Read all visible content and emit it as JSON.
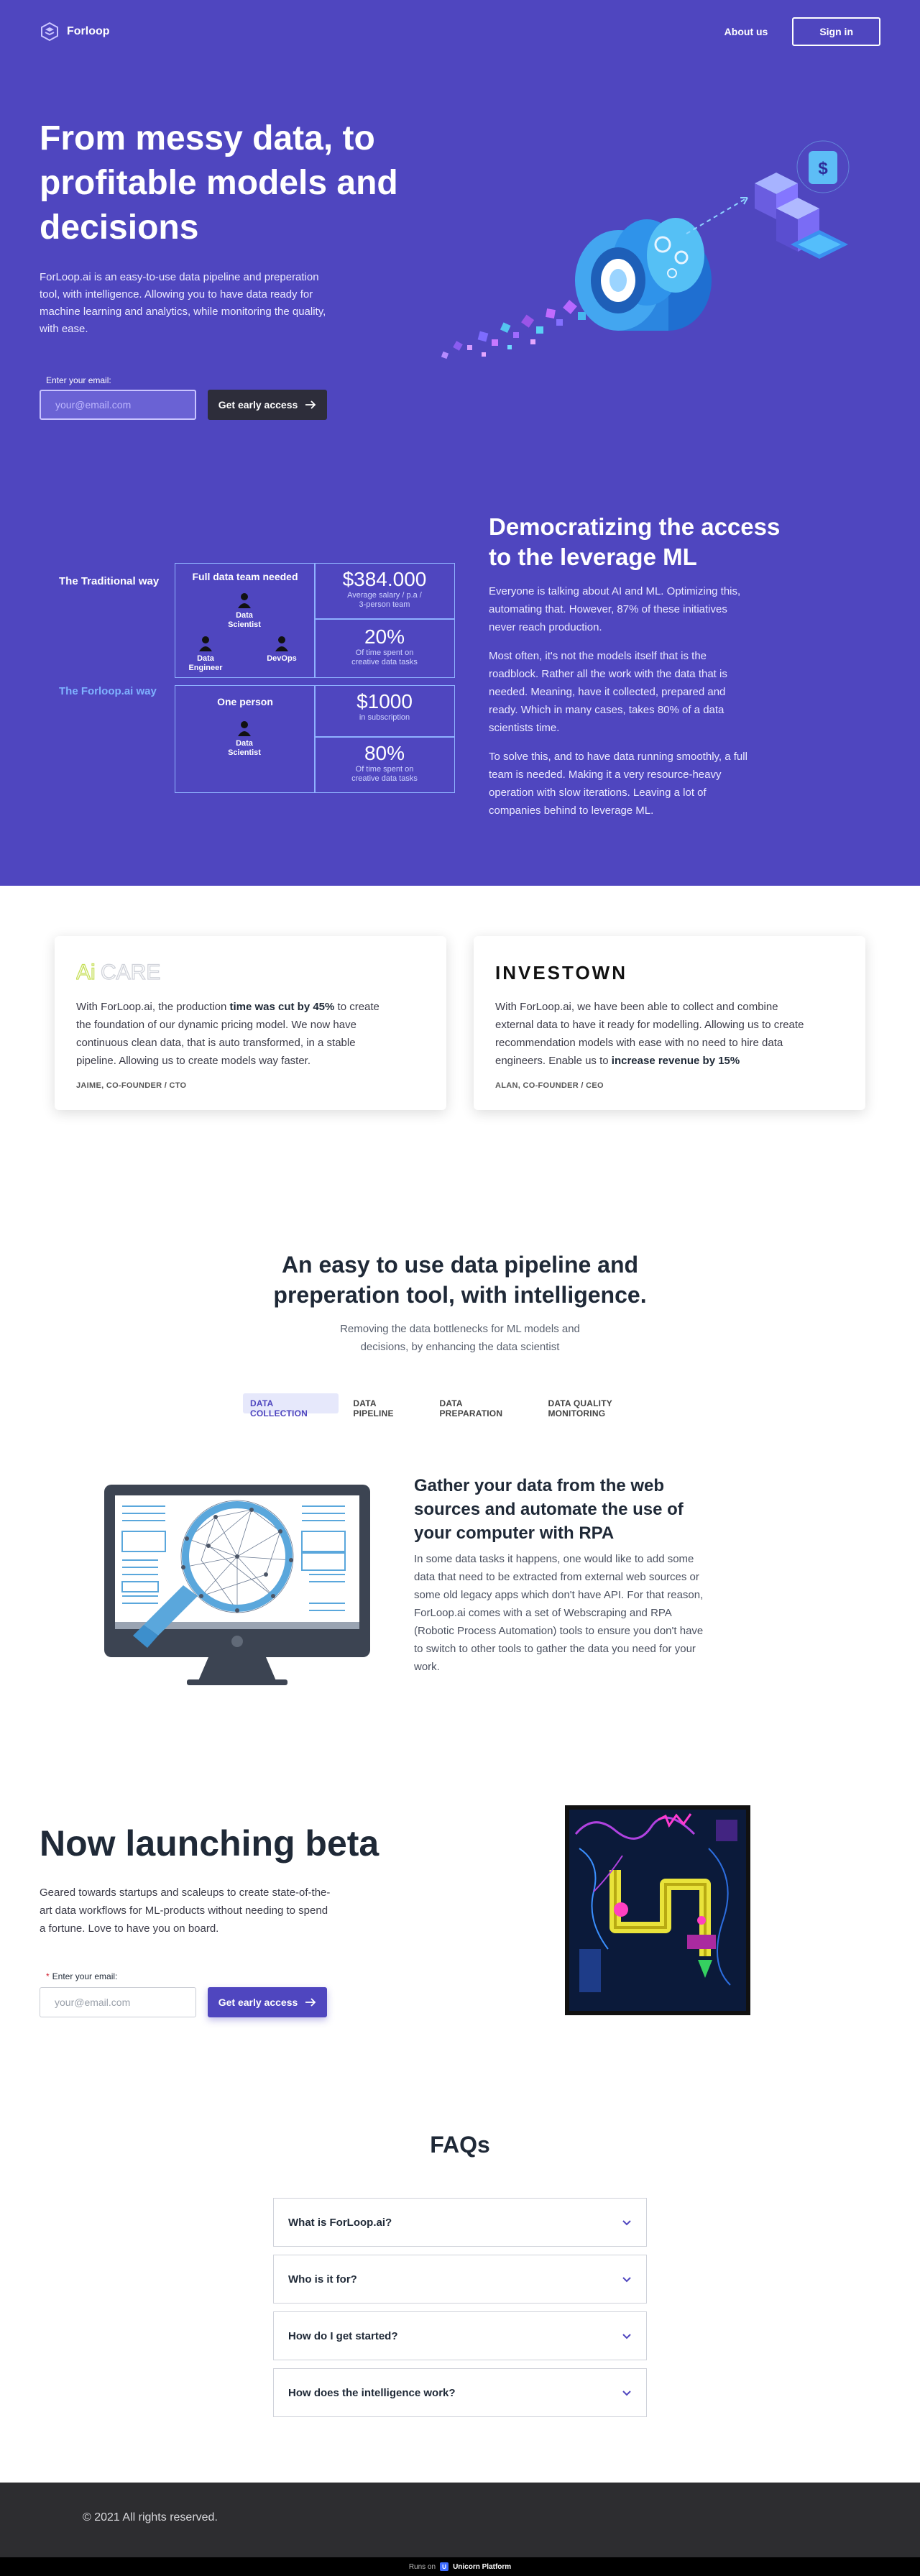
{
  "colors": {
    "brand": "#4f46bf",
    "dark_button": "#2d2d3a",
    "footer": "#2d2d30",
    "traditional": "#ffffff",
    "forloop": "#7fb2ff"
  },
  "nav": {
    "brand_name": "Forloop",
    "about": "About us",
    "signin": "Sign in"
  },
  "hero": {
    "title": "From messy data, to profitable models and decisions",
    "subtitle": "ForLoop.ai is an easy-to-use data pipeline and preperation tool, with intelligence. Allowing you to have data ready for machine learning and analytics, while monitoring the quality, with ease.",
    "email_label": "Enter your email:",
    "email_placeholder": "your@email.com",
    "cta": "Get early access"
  },
  "comparison": {
    "traditional_label": "The Traditional way",
    "forloop_label": "The Forloop.ai way",
    "traditional": {
      "team_title": "Full data team needed",
      "roles": [
        "Data Scientist",
        "Data Engineer",
        "DevOps"
      ],
      "salary": "$384.000",
      "salary_note": "Average salary / p.a / 3-person team",
      "time": "20%",
      "time_note": "Of time spent on creative data tasks"
    },
    "forloop": {
      "team_title": "One person",
      "roles": [
        "Data Scientist"
      ],
      "price": "$1000",
      "price_note": "in subscription",
      "time": "80%",
      "time_note": "Of time spent on creative data tasks"
    }
  },
  "democratizing": {
    "title": "Democratizing the access to the leverage ML",
    "p1": "Everyone is talking about AI and ML. Optimizing this, automating that. However, 87% of these initiatives never reach production.",
    "p2": "Most often, it's not the models itself that is the roadblock. Rather all the work with the data that is needed. Meaning, have it collected, prepared and ready. Which in many cases, takes 80% of a data scientists time.",
    "p3": "To solve this, and to have data running smoothly, a full team is needed. Making it a very resource-heavy operation with slow iterations. Leaving a lot of companies behind to leverage ML."
  },
  "testimonials": [
    {
      "logo": "AiCARE",
      "quote_pre": "With ForLoop.ai, the production ",
      "quote_bold": "time was cut by 45%",
      "quote_post": " to create the foundation of our dynamic pricing model. We now have continuous clean data, that is auto transformed, in a stable pipeline. Allowing us to create models way faster.",
      "author": "JAIME, CO-FOUNDER / CTO"
    },
    {
      "logo": "INVESTOWN",
      "quote_pre": "With ForLoop.ai, we have been able to collect and combine external data to have it ready for modelling. Allowing us to create recommendation models with ease with no need to hire data engineers. Enable us to ",
      "quote_bold": "increase revenue by 15%",
      "quote_post": "",
      "author": "ALAN, CO-FOUNDER / CEO"
    }
  ],
  "pipeline": {
    "title": "An easy to use data pipeline and preperation tool, with intelligence.",
    "subtitle": "Removing the data bottlenecks for ML models and decisions, by enhancing the data scientist",
    "tabs": [
      "DATA COLLECTION",
      "DATA PIPELINE",
      "DATA PREPARATION",
      "DATA QUALITY MONITORING"
    ],
    "feature_title": "Gather your data from the web sources and automate the use of your computer with RPA",
    "feature_text": "In some data tasks it happens, one would like to add some data that need to be extracted from external web sources or some old legacy apps which don't have API. For that reason, ForLoop.ai comes with a set of Webscraping and RPA (Robotic Process Automation) tools to ensure you don't have to switch to other tools to gather the data you need for your work."
  },
  "beta": {
    "title": "Now launching beta",
    "text": "Geared towards startups and scaleups to create state-of-the-art data workflows for ML-products without needing to spend a fortune. Love to have you on board.",
    "required_mark": "*",
    "email_label": "Enter your email:",
    "email_placeholder": "your@email.com",
    "cta": "Get early access"
  },
  "faq": {
    "title": "FAQs",
    "questions": [
      "What is ForLoop.ai?",
      "Who is it for?",
      "How do I get started?",
      "How does the intelligence work?"
    ]
  },
  "footer": {
    "copyright": "© 2021 All rights reserved.",
    "runs_on": "Runs on",
    "platform": "Unicorn Platform"
  }
}
